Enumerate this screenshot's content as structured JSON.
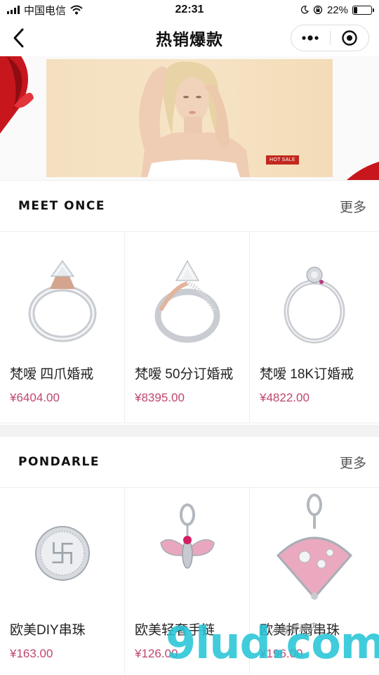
{
  "status_bar": {
    "carrier": "中国电信",
    "time": "22:31",
    "battery_percent": "22%",
    "battery_level": 0.22,
    "icons": [
      "signal-icon",
      "wifi-icon",
      "moon-icon",
      "rotation-lock-icon",
      "battery-icon"
    ]
  },
  "nav": {
    "title": "热销爆款",
    "back_icon": "back-arrow-icon",
    "menu_icon": "more-dots-icon",
    "close_icon": "target-circle-icon"
  },
  "banner": {
    "badge": "HOT SALE"
  },
  "sections": [
    {
      "brand": "MEET ONCE",
      "more_label": "更多",
      "products": [
        {
          "name": "梵嗳 四爪婚戒",
          "price": "¥6404.00",
          "image": "solitaire-ring-image"
        },
        {
          "name": "梵嗳 50分订婚戒",
          "price": "¥8395.00",
          "image": "twisted-ring-image"
        },
        {
          "name": "梵嗳 18K订婚戒",
          "price": "¥4822.00",
          "image": "flower-ring-image"
        }
      ]
    },
    {
      "brand": "PONDARLE",
      "more_label": "更多",
      "products": [
        {
          "name": "欧美DIY串珠",
          "price": "¥163.00",
          "image": "bead-charm-image"
        },
        {
          "name": "欧美轻奢手链",
          "price": "¥126.00",
          "image": "bee-charm-image"
        },
        {
          "name": "欧美折扇串珠",
          "price": "¥196.00",
          "image": "fan-charm-image"
        }
      ]
    }
  ],
  "watermark": {
    "text": "9lud.com",
    "sub": "小程序商店"
  },
  "colors": {
    "price": "#c0466b",
    "ribbon": "#c8161d",
    "divider": "#eeeeee",
    "watermark": "#27c5d8"
  }
}
